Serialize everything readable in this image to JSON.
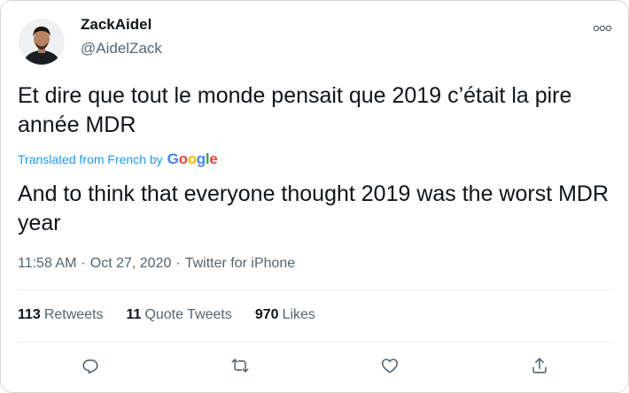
{
  "tweet": {
    "author_name": "ZackAidel",
    "author_handle": "@AidelZack",
    "text_original": "Et dire que tout le monde pensait que 2019 c’était la pire année MDR",
    "translation_label": "Translated from French by",
    "translation_provider": "Google",
    "text_translated": "And to think that everyone thought 2019 was the worst MDR year",
    "time": "11:58 AM",
    "date": "Oct 27, 2020",
    "source": "Twitter for iPhone",
    "separator": "·"
  },
  "stats": {
    "retweets_count": "113",
    "retweets_label": "Retweets",
    "quotes_count": "11",
    "quotes_label": "Quote Tweets",
    "likes_count": "970",
    "likes_label": "Likes"
  },
  "actions": [
    "reply-icon",
    "retweet-icon",
    "like-icon",
    "share-icon"
  ],
  "colors": {
    "text": "#0f1419",
    "secondary": "#536471",
    "link": "#1d9bf0",
    "divider": "#e6ecf0",
    "google_blue": "#4285F4",
    "google_red": "#EA4335",
    "google_yellow": "#FBBC05",
    "google_green": "#34A853"
  }
}
